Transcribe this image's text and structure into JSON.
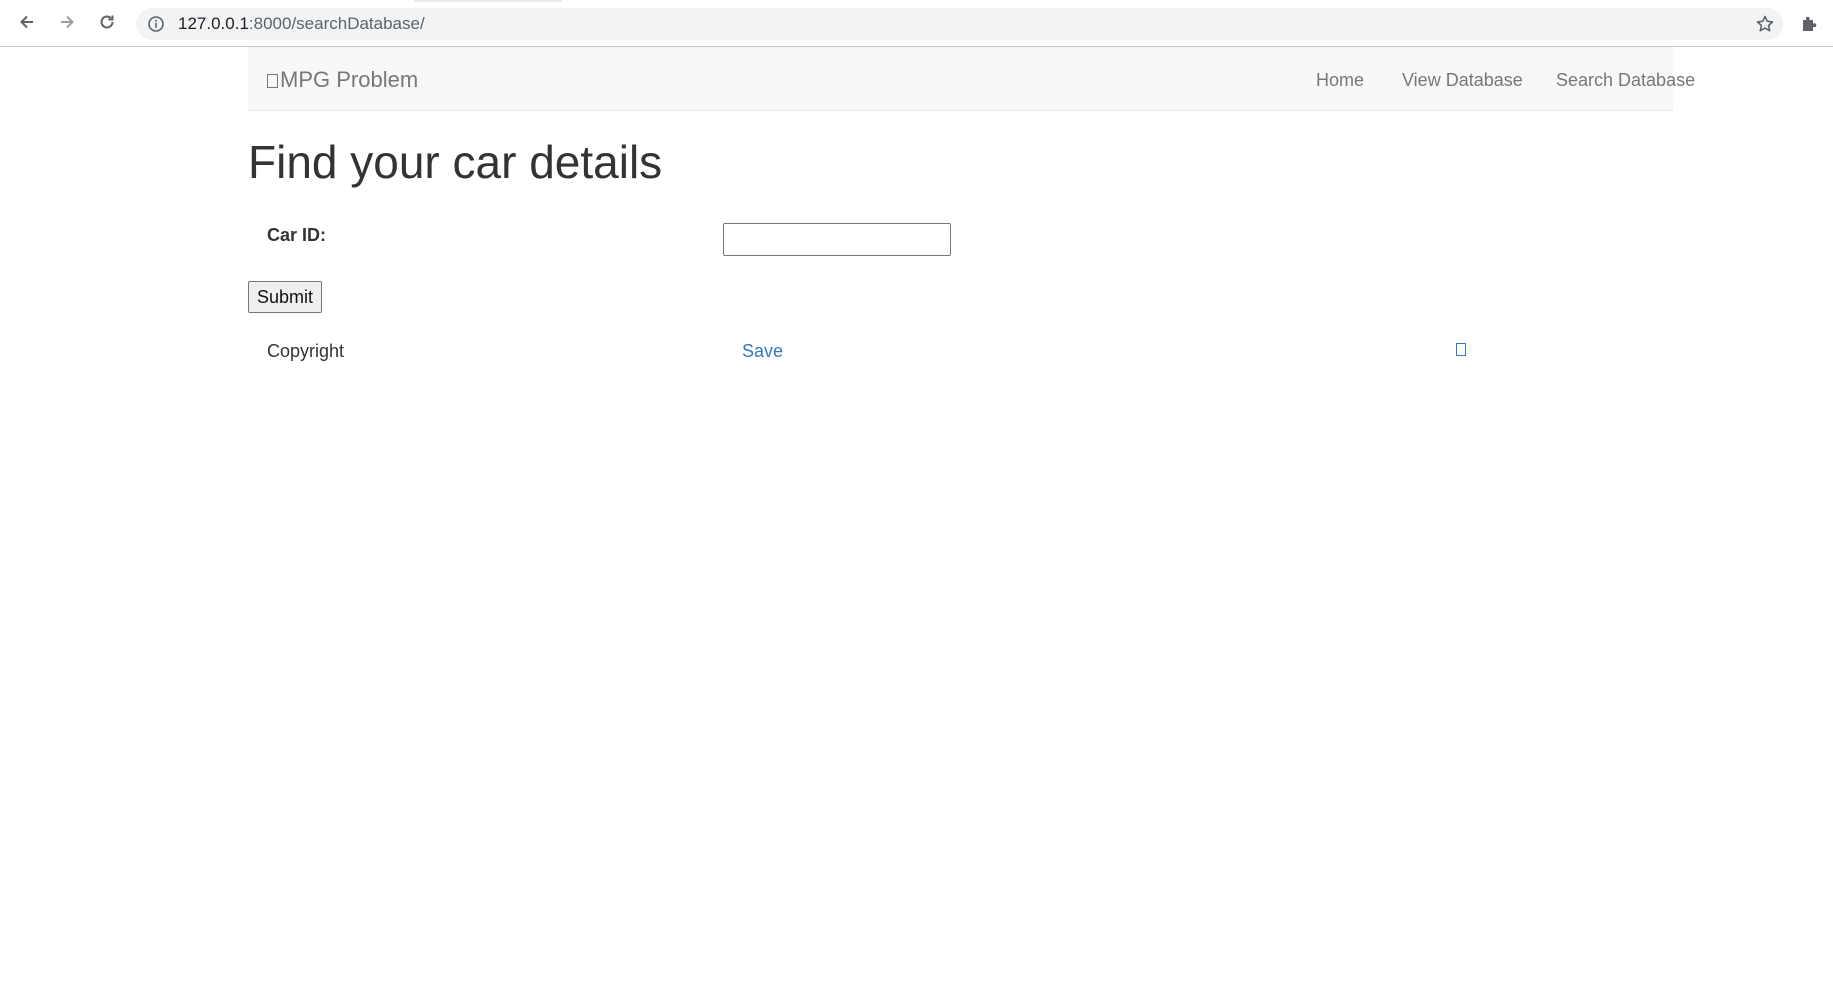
{
  "browser": {
    "url_host": "127.0.0.1",
    "url_rest": ":8000/searchDatabase/",
    "back_icon": "arrow-left-icon",
    "forward_icon": "arrow-right-icon",
    "reload_icon": "reload-icon",
    "site_info_icon": "info-icon",
    "bookmark_icon": "star-icon",
    "extensions_icon": "puzzle-icon"
  },
  "navbar": {
    "brand": "MPG Problem",
    "links": [
      "Home",
      "View Database",
      "Search Database"
    ]
  },
  "main": {
    "title": "Find your car details",
    "car_id_label": "Car ID:",
    "car_id_value": "",
    "submit_label": "Submit"
  },
  "footer": {
    "copyright": "Copyright",
    "save_link": "Save"
  },
  "colors": {
    "link": "#337ab7",
    "navbar_bg": "#f8f8f8",
    "navbar_text": "#777777"
  }
}
